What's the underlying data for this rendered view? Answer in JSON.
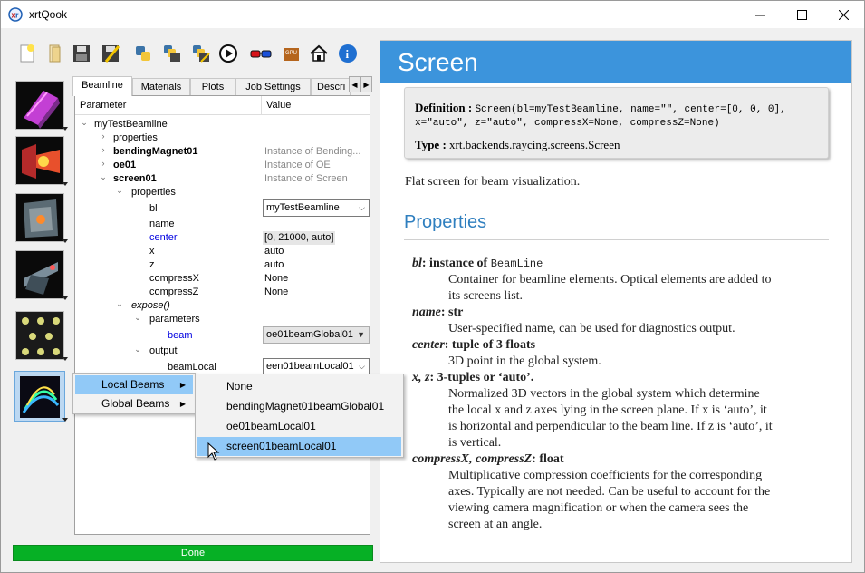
{
  "window": {
    "title": "xrtQook"
  },
  "toolbar": {
    "items": [
      "new-file-icon",
      "open-folder-icon",
      "save-icon",
      "save-as-icon",
      "python-code-icon",
      "save-script-icon",
      "save-script-as-icon",
      "run-icon",
      "3d-glasses-icon",
      "gpu-icon",
      "home-icon",
      "info-icon"
    ]
  },
  "sidebar": {
    "items": [
      "sources",
      "optical-elements",
      "screens",
      "apertures",
      "materials",
      "plots"
    ]
  },
  "tabs": [
    "Beamline",
    "Materials",
    "Plots",
    "Job Settings",
    "Descri"
  ],
  "tree": {
    "header_param": "Parameter",
    "header_value": "Value",
    "root": "myTestBeamline",
    "properties": "properties",
    "bm_name": "bendingMagnet01",
    "bm_value": "Instance of Bending...",
    "oe_name": "oe01",
    "oe_value": "Instance of OE",
    "screen_name": "screen01",
    "screen_value": "Instance of Screen",
    "sub_properties": "properties",
    "params": [
      {
        "name": "bl",
        "value": "myTestBeamline"
      },
      {
        "name": "name",
        "value": ""
      },
      {
        "name": "center",
        "value": "[0, 21000, auto]"
      },
      {
        "name": "x",
        "value": "auto"
      },
      {
        "name": "z",
        "value": "auto"
      },
      {
        "name": "compressX",
        "value": "None"
      },
      {
        "name": "compressZ",
        "value": "None"
      }
    ],
    "expose": "expose()",
    "parameters": "parameters",
    "beam_label": "beam",
    "beam_value": "oe01beamGlobal01",
    "output": "output",
    "beamlocal_label": "beamLocal",
    "beamlocal_value": "een01beamLocal01"
  },
  "context_menu": {
    "items": [
      "Local Beams",
      "Global Beams"
    ],
    "selected": "Local Beams",
    "submenu": [
      "None",
      "bendingMagnet01beamGlobal01",
      "oe01beamLocal01",
      "screen01beamLocal01"
    ],
    "submenu_selected": "screen01beamLocal01"
  },
  "status": {
    "text": "Done",
    "color": "#06b025"
  },
  "doc": {
    "title": "Screen",
    "definition_label": "Definition :",
    "definition_line1": "Screen(bl=myTestBeamline, name=\"\", center=[0, 0, 0],",
    "definition_line2": "x=\"auto\", z=\"auto\", compressX=None, compressZ=None)",
    "type_label": "Type :",
    "type_value": "xrt.backends.raycing.screens.Screen",
    "summary": "Flat screen for beam visualization.",
    "properties_heading": "Properties",
    "props": [
      {
        "name": "bl",
        "type_text": ": instance of ",
        "type_mono": "BeamLine",
        "lines": [
          "Container for beamline elements. Optical elements are added to",
          "its screens list."
        ]
      },
      {
        "name": "name",
        "type_text": ": str",
        "type_mono": "",
        "lines": [
          "User-specified name, can be used for diagnostics output."
        ]
      },
      {
        "name": "center",
        "type_text": ": tuple of 3 floats",
        "type_mono": "",
        "lines": [
          "3D point in the global system."
        ]
      },
      {
        "name": "x, z",
        "type_text": ": 3-tuples or ‘auto’.",
        "type_mono": "",
        "lines": [
          "Normalized 3D vectors in the global system which determine",
          "the local x and z axes lying in the screen plane. If x is ‘auto’, it",
          "is horizontal and perpendicular to the beam line. If z is ‘auto’, it",
          "is vertical."
        ]
      },
      {
        "name": "compressX, compressZ",
        "type_text": ": float",
        "type_mono": "",
        "lines": [
          "Multiplicative compression coefficients for the corresponding",
          "axes. Typically are not needed. Can be useful to account for the",
          "viewing camera magnification or when the camera sees the",
          "screen at an angle."
        ]
      }
    ]
  }
}
